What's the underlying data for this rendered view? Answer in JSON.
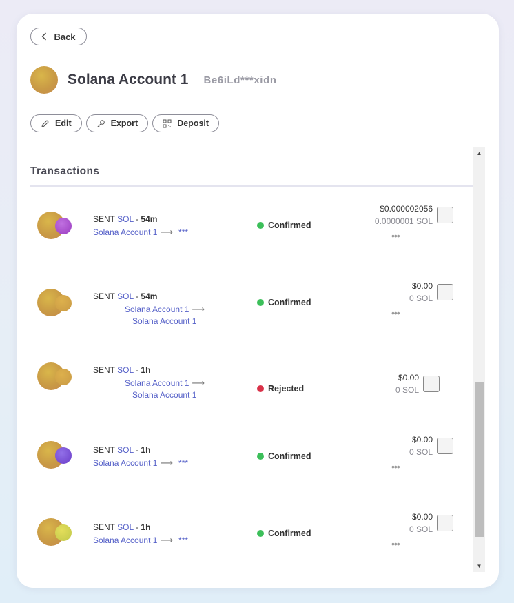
{
  "back": {
    "label": "Back"
  },
  "account": {
    "name": "Solana Account 1",
    "address": "Be6iLd***xidn"
  },
  "actions": [
    {
      "label": "Edit",
      "icon": "pencil-icon"
    },
    {
      "label": "Export",
      "icon": "key-icon"
    },
    {
      "label": "Deposit",
      "icon": "qr-code-icon"
    }
  ],
  "section": {
    "title": "Transactions"
  },
  "transactions": [
    {
      "type": "SENT",
      "token": "SOL",
      "sep": "-",
      "time": "54m",
      "from": "Solana Account 1",
      "to": "***",
      "to_is_account": false,
      "status": "Confirmed",
      "status_color": "#3cbf5a",
      "usd": "$0.000002056",
      "sol": "0.0000001 SOL",
      "secondary_token_color": "#a251c8"
    },
    {
      "type": "SENT",
      "token": "SOL",
      "sep": "-",
      "time": "54m",
      "from": "Solana Account 1",
      "to": "Solana Account 1",
      "to_is_account": true,
      "status": "Confirmed",
      "status_color": "#3cbf5a",
      "usd": "$0.00",
      "sol": "0 SOL",
      "secondary_token_color": "#d4a845"
    },
    {
      "type": "SENT",
      "token": "SOL",
      "sep": "-",
      "time": "1h",
      "from": "Solana Account 1",
      "to": "Solana Account 1",
      "to_is_account": true,
      "status": "Rejected",
      "status_color": "#d93148",
      "usd": "$0.00",
      "sol": "0 SOL",
      "secondary_token_color": "#d4a845"
    },
    {
      "type": "SENT",
      "token": "SOL",
      "sep": "-",
      "time": "1h",
      "from": "Solana Account 1",
      "to": "***",
      "to_is_account": false,
      "status": "Confirmed",
      "status_color": "#3cbf5a",
      "usd": "$0.00",
      "sol": "0 SOL",
      "secondary_token_color": "#7b4fd8"
    },
    {
      "type": "SENT",
      "token": "SOL",
      "sep": "-",
      "time": "1h",
      "from": "Solana Account 1",
      "to": "***",
      "to_is_account": false,
      "status": "Confirmed",
      "status_color": "#3cbf5a",
      "usd": "$0.00",
      "sol": "0 SOL",
      "secondary_token_color": "#d8d04a"
    }
  ],
  "more_glyph": "•••"
}
